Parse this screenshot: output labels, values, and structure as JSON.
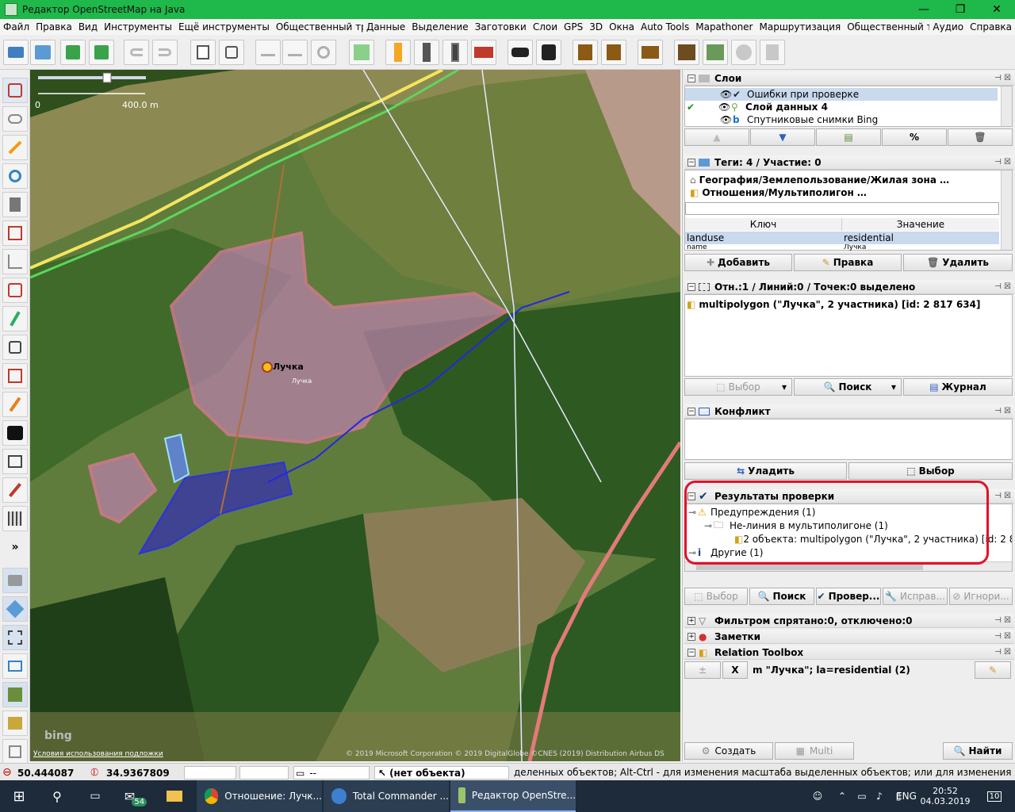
{
  "window": {
    "title": "Редактор OpenStreetMap на Java",
    "minimize": "—",
    "maximize": "❐",
    "close": "✕"
  },
  "menu": [
    "Файл",
    "Правка",
    "Вид",
    "Инструменты",
    "Ещё инструменты",
    "Общественный транспорт",
    "Данные",
    "Выделение",
    "Заготовки",
    "Слои",
    "GPS",
    "3D",
    "Окна",
    "Auto Tools",
    "Mapathoner",
    "Маршрутизация",
    "Общественный транспорт",
    "Аудио",
    "Справка"
  ],
  "map": {
    "scale_zero": "0",
    "scale_label": "400.0 m",
    "place_name": "Лучка",
    "place_sub": "Лучка",
    "bing_logo": "bing",
    "terms_link": "Условия использования подложки",
    "copyright": "© 2019 Microsoft Corporation © 2019 DigitalGlobe ©CNES (2019) Distribution Airbus DS"
  },
  "layers": {
    "title": "Слои",
    "items": [
      {
        "name": "Ошибки при проверке",
        "active": false,
        "selected": true
      },
      {
        "name": "Слой данных 4",
        "active": true,
        "selected": false
      },
      {
        "name": "Спутниковые снимки Bing",
        "active": false,
        "selected": false
      }
    ]
  },
  "tags": {
    "title": "Теги: 4 / Участие: 0",
    "preset1": "География/Землепользование/Жилая зона …",
    "preset2": "Отношения/Мультиполигон …",
    "col_key": "Ключ",
    "col_value": "Значение",
    "rows": [
      {
        "key": "landuse",
        "value": "residential"
      },
      {
        "key": "name",
        "value": "Лучка"
      }
    ],
    "add": "Добавить",
    "edit": "Правка",
    "delete": "Удалить"
  },
  "selection": {
    "title": "Отн.:1 / Линий:0 / Точек:0 выделено",
    "item": "multipolygon (\"Лучка\", 2 участника) [id: 2 817 634]",
    "select": "Выбор",
    "search": "Поиск",
    "history": "Журнал"
  },
  "conflict": {
    "title": "Конфликт",
    "resolve": "Уладить",
    "select": "Выбор"
  },
  "validation": {
    "title": "Результаты проверки",
    "warnings": "Предупреждения (1)",
    "nonline": "Не-линия в мультиполигоне (1)",
    "objects": "2 объекта: multipolygon (\"Лучка\", 2 участника) [id: 2 817 634]",
    "others": "Другие (1)",
    "select": "Выбор",
    "search": "Поиск",
    "validate": "Провер...",
    "fix": "Исправ...",
    "ignore": "Игнори..."
  },
  "filter": {
    "title": "Фильтром спрятано:0, отключено:0"
  },
  "notes": {
    "title": "Заметки"
  },
  "relation_toolbox": {
    "title": "Relation Toolbox",
    "x": "X",
    "value": "m \"Лучка\"; la=residential (2)",
    "create": "Создать",
    "multi": "Multi",
    "find": "Найти"
  },
  "status": {
    "lat": "50.444087",
    "lon": "34.9367809",
    "dist": "--",
    "object": "(нет объекта)",
    "hint": "деленных объектов; Alt-Ctrl - для изменения масштаба выделенных объектов; или для изменения выделения"
  },
  "taskbar": {
    "mail_badge": "54",
    "tasks": [
      "Отношение: Лучк...",
      "Total Commander ...",
      "Редактор OpenStre..."
    ],
    "lang": "ENG",
    "time": "20:52",
    "date": "04.03.2019",
    "notif": "10"
  }
}
